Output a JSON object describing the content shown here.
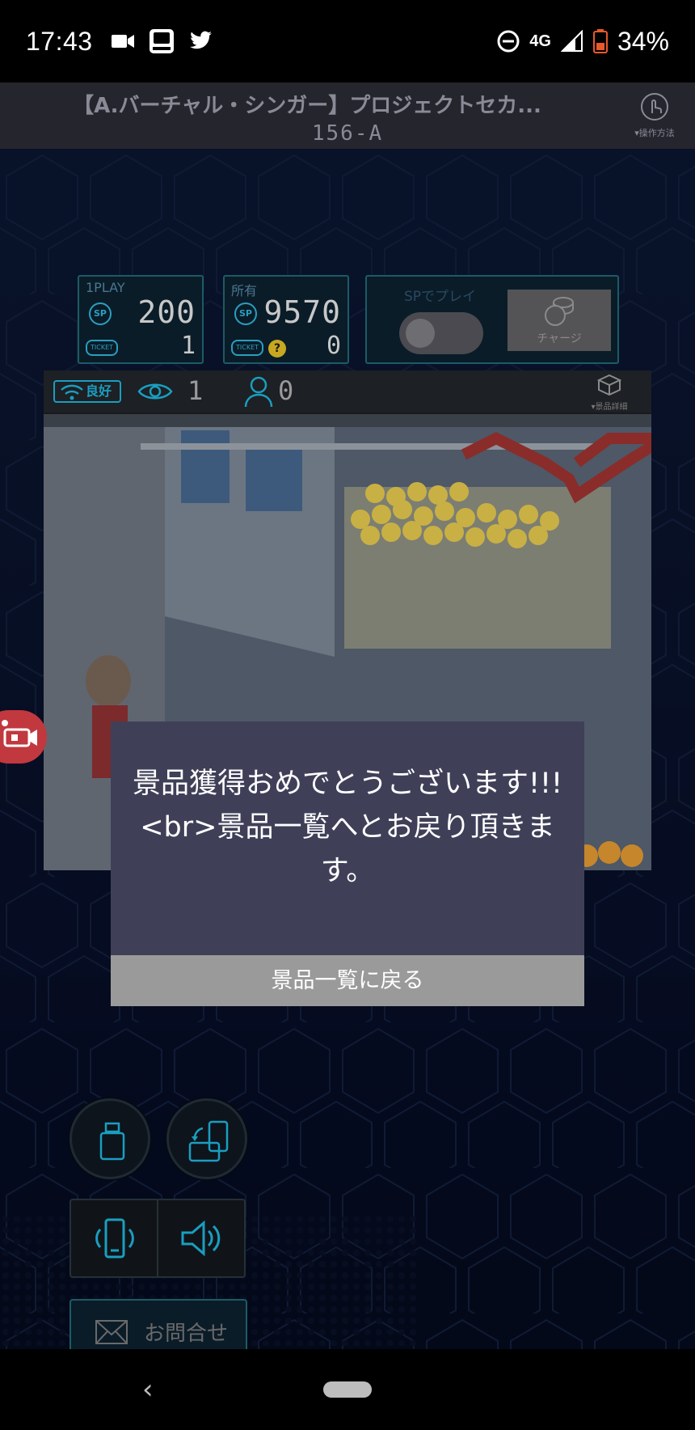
{
  "status_bar": {
    "time": "17:43",
    "network": "4G",
    "battery": "34%"
  },
  "header": {
    "title": "【A.バーチャル・シンガー】プロジェクトセカ...",
    "machine_id": "156-A",
    "help_label": "▾操作方法"
  },
  "panels": {
    "play": {
      "label": "1PLAY",
      "sp_value": "200",
      "ticket_value": "1"
    },
    "owned": {
      "label": "所有",
      "sp_value": "9570",
      "ticket_value": "0"
    },
    "sp_mode": {
      "label": "SPでプレイ",
      "charge_label": "チャージ"
    },
    "sp_badge": "SP",
    "ticket_badge": "TICKET",
    "help_badge": "?"
  },
  "camera": {
    "connection_label": "良好",
    "viewers": "1",
    "players": "0",
    "prize_detail_label": "▾景品詳細"
  },
  "modal": {
    "message": "景品獲得おめでとうございます!!!<br>景品一覧へとお戻り頂きます。",
    "button_label": "景品一覧に戻る"
  },
  "contact": {
    "label": "お問合せ"
  },
  "icons": [
    "video-icon",
    "app-icon",
    "twitter-icon",
    "dnd-icon",
    "signal-icon",
    "battery-icon",
    "hand-pointer-icon",
    "wifi-icon",
    "eye-icon",
    "person-icon",
    "box-icon",
    "camera-icon",
    "sp-coin-icon",
    "ticket-icon",
    "claw-icon",
    "rotate-device-icon",
    "vibrate-icon",
    "speaker-icon",
    "mail-icon",
    "back-icon",
    "home-icon"
  ],
  "colors": {
    "accent": "#1a9ec0",
    "modal_bg": "#3f4058",
    "modal_button": "#9a9a9a",
    "camera_tab": "#c1383e"
  }
}
